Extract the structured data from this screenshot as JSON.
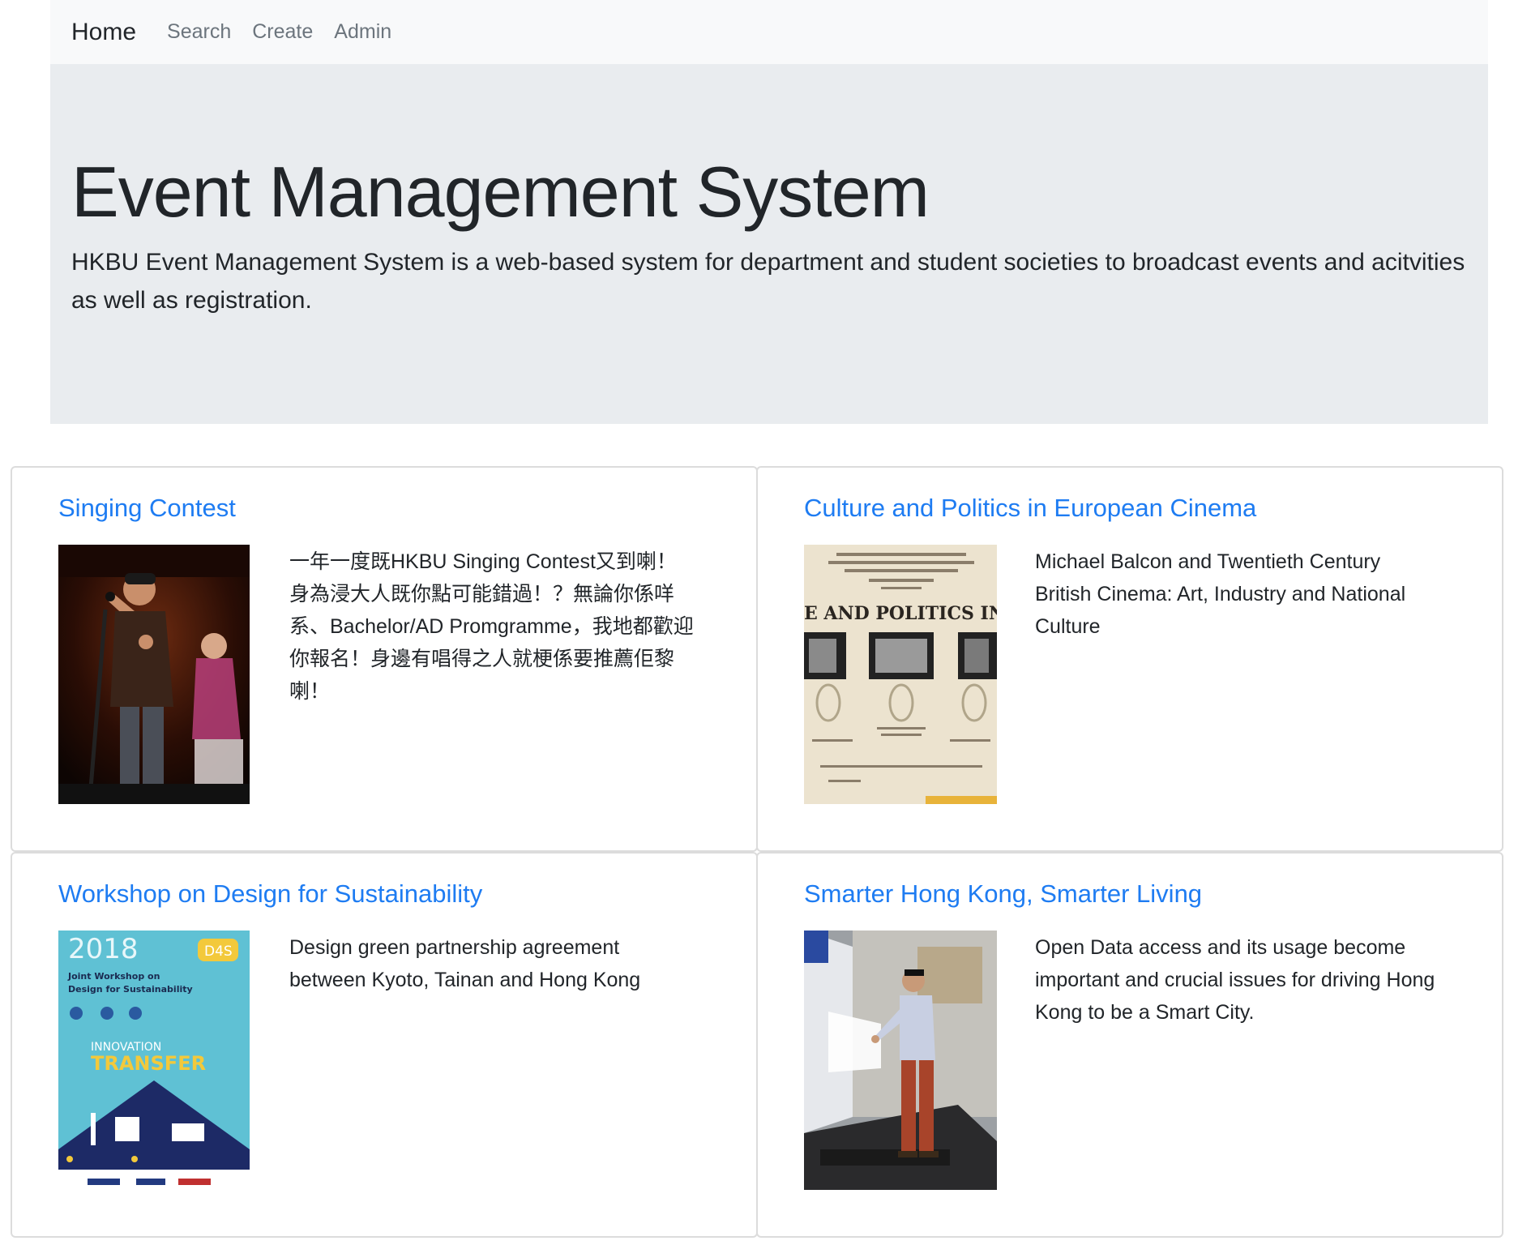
{
  "nav": {
    "brand": "Home",
    "links": [
      "Search",
      "Create",
      "Admin"
    ]
  },
  "jumbotron": {
    "title": "Event Management System",
    "lead": "HKBU Event Management System is a web-based system for department and student societies to broadcast events and acitvities as well as registration."
  },
  "events": [
    {
      "title": "Singing Contest",
      "description": "一年一度既HKBU Singing Contest又到喇！身為浸大人既你點可能錯過！？無論你係咩系、Bachelor/AD Promgramme，我地都歡迎你報名！身邊有唱得之人就梗係要推薦佢黎喇！",
      "image": "singer-photo"
    },
    {
      "title": "Culture and Politics in European Cinema",
      "description": "Michael Balcon and Twentieth Century British Cinema: Art, Industry and National Culture",
      "image": "cinema-poster",
      "poster_headline": "E AND POLITICS IN EUROPEAN"
    },
    {
      "title": "Workshop on Design for Sustainability",
      "description": "Design green partnership agreement between Kyoto, Tainan and Hong Kong",
      "image": "workshop-poster",
      "poster_text": {
        "year": "2018",
        "badge": "D4S",
        "line1": "Joint Workshop on",
        "line2": "Design for Sustainability",
        "innovation": "INNOVATION",
        "transfer": "TRANSFER"
      }
    },
    {
      "title": "Smarter Hong Kong, Smarter Living",
      "description": "Open Data access and its usage become important and crucial issues for driving Hong Kong to be a Smart City.",
      "image": "presenter-photo"
    }
  ],
  "colors": {
    "link": "#1e7cf2",
    "navbar_bg": "#f8f9fa",
    "jumbotron_bg": "#e9ecef"
  }
}
